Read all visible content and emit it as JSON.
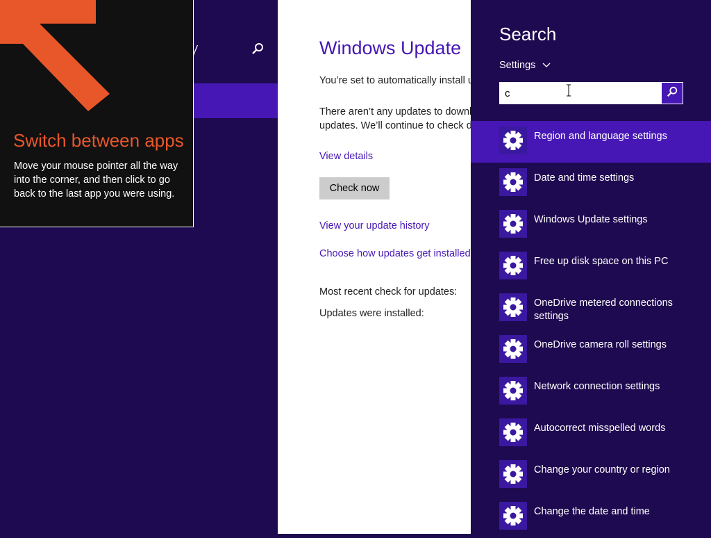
{
  "background_app": {
    "title_partial": "y",
    "colors": {
      "background": "#1e0a50",
      "accent": "#4617b4"
    }
  },
  "tip": {
    "title": "Switch between apps",
    "body": "Move your mouse pointer all the way into the corner, and then click to go back to the last app you were using.",
    "colors": {
      "title": "#e8572a",
      "arrow": "#e8572a"
    }
  },
  "windows_update": {
    "title": "Windows Update",
    "auto_install_text": "You’re set to automatically install u",
    "no_updates_line1": "There aren’t any updates to downlc",
    "no_updates_line2": "updates. We’ll continue to check da",
    "view_details": "View details",
    "check_now": "Check now",
    "view_history": "View your update history",
    "choose_how": "Choose how updates get installed",
    "most_recent": "Most recent check for updates:",
    "updates_installed": "Updates were installed:"
  },
  "search_charm": {
    "title": "Search",
    "scope": "Settings",
    "query": "c",
    "results": [
      {
        "label": "Region and language settings",
        "icon": "gear-icon",
        "selected": true
      },
      {
        "label": "Date and time settings",
        "icon": "gear-icon"
      },
      {
        "label": "Windows Update settings",
        "icon": "gear-icon"
      },
      {
        "label": "Free up disk space on this PC",
        "icon": "gear-icon"
      },
      {
        "label": "OneDrive metered connections settings",
        "icon": "gear-icon"
      },
      {
        "label": "OneDrive camera roll settings",
        "icon": "gear-icon"
      },
      {
        "label": "Network connection settings",
        "icon": "gear-icon"
      },
      {
        "label": "Autocorrect misspelled words",
        "icon": "gear-icon"
      },
      {
        "label": "Change your country or region",
        "icon": "gear-icon"
      },
      {
        "label": "Change the date and time",
        "icon": "gear-icon"
      }
    ]
  }
}
